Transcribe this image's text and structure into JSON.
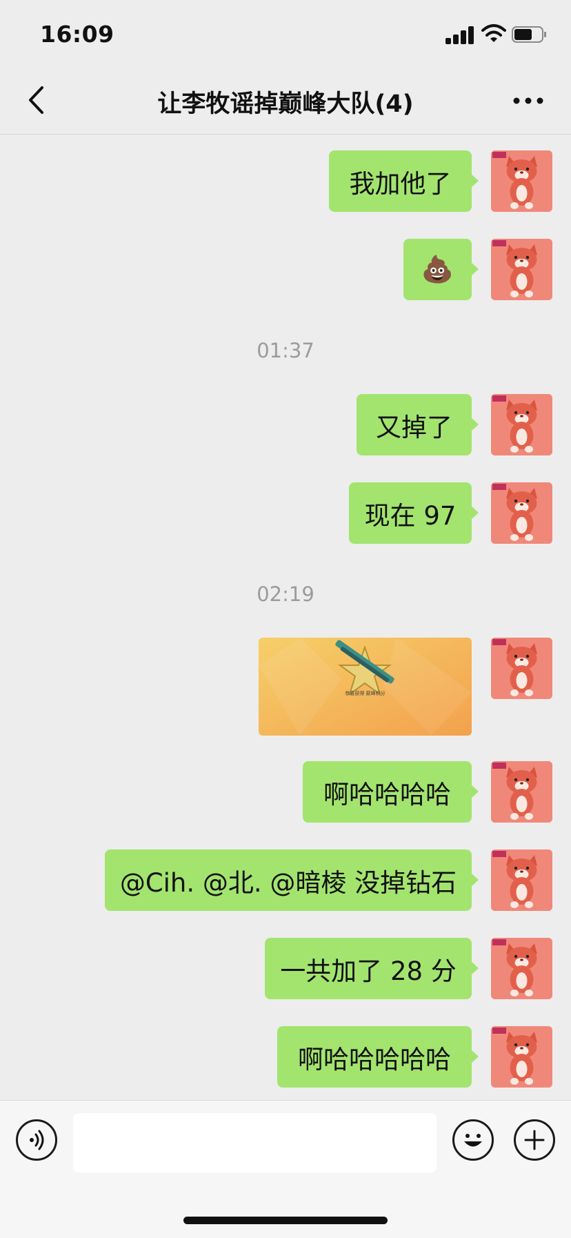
{
  "status_bar": {
    "time": "16:09",
    "signal_icon": "cellular-signal-icon",
    "wifi_icon": "wifi-icon",
    "battery_icon": "battery-icon"
  },
  "nav": {
    "back_icon": "chevron-left-icon",
    "title": "让李牧谣掉巅峰大队(4)",
    "more_icon": "more-dots-icon"
  },
  "messages": [
    {
      "type": "text",
      "text": "我加他了"
    },
    {
      "type": "emoji",
      "text": "💩"
    },
    {
      "type": "timestamp",
      "text": "01:37"
    },
    {
      "type": "text",
      "text": "又掉了"
    },
    {
      "type": "text",
      "text": "现在 97"
    },
    {
      "type": "timestamp",
      "text": "02:19"
    },
    {
      "type": "image",
      "image_text": "恭喜获得 巅峰积分"
    },
    {
      "type": "text",
      "text": "啊哈哈哈哈"
    },
    {
      "type": "text",
      "text": "@Cih. @北. @暗棱 没掉钻石"
    },
    {
      "type": "text",
      "text": "一共加了 28 分"
    },
    {
      "type": "text",
      "text": "啊哈哈哈哈哈"
    }
  ],
  "avatar": {
    "icon": "red-cat-plush-avatar",
    "brand_text": "NICI"
  },
  "input_bar": {
    "voice_icon": "voice-icon",
    "input_value": "",
    "emoji_icon": "smiley-icon",
    "plus_icon": "plus-icon"
  },
  "colors": {
    "background": "#ededed",
    "bubble": "#a3e46f",
    "avatar": "#f0887a",
    "timestamp": "#9b9b9b"
  }
}
